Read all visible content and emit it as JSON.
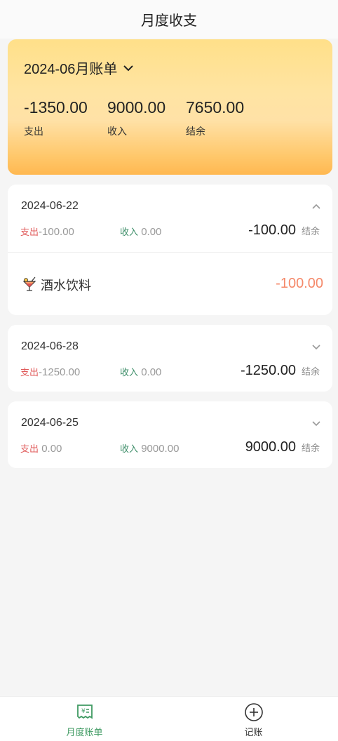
{
  "header": {
    "title": "月度收支"
  },
  "summary": {
    "month_label": "2024-06月账单",
    "expense": {
      "value": "-1350.00",
      "label": "支出"
    },
    "income": {
      "value": "9000.00",
      "label": "收入"
    },
    "balance": {
      "value": "7650.00",
      "label": "结余"
    }
  },
  "days": [
    {
      "date": "2024-06-22",
      "expanded": true,
      "expense_label": "支出",
      "expense_value": "-100.00",
      "income_label": "收入",
      "income_value": "0.00",
      "balance_value": "-100.00",
      "balance_label": "结余",
      "entries": [
        {
          "icon": "cocktail-drink-icon",
          "name": "酒水饮料",
          "amount": "-100.00"
        }
      ]
    },
    {
      "date": "2024-06-28",
      "expanded": false,
      "expense_label": "支出",
      "expense_value": "-1250.00",
      "income_label": "收入",
      "income_value": "0.00",
      "balance_value": "-1250.00",
      "balance_label": "结余"
    },
    {
      "date": "2024-06-25",
      "expanded": false,
      "expense_label": "支出",
      "expense_value": "0.00",
      "income_label": "收入",
      "income_value": "9000.00",
      "balance_value": "9000.00",
      "balance_label": "结余"
    }
  ],
  "tabbar": {
    "items": [
      {
        "label": "月度账单",
        "icon": "bill-icon",
        "active": true
      },
      {
        "label": "记账",
        "icon": "add-circle-icon",
        "active": false
      }
    ]
  },
  "colors": {
    "expense": "#e05a5a",
    "income": "#3f8f6a",
    "entry_amount": "#f5896a",
    "active_tab": "#3f9a62"
  }
}
